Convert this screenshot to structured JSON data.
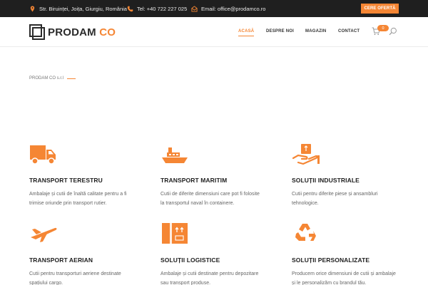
{
  "topbar": {
    "address": "Str. Biruinței, Joița, Giurgiu, România",
    "phone": "Tel: +40 722 227 025",
    "email": "Email: office@prodamco.ro",
    "cta_label": "CERE OFERTĂ",
    "icons": [
      "location-icon",
      "phone-icon",
      "email-icon"
    ]
  },
  "header": {
    "logo_main": "PRODAM",
    "logo_accent": "CO",
    "nav": [
      "ACASĂ",
      "DESPRE NOI",
      "MAGAZIN",
      "CONTACT"
    ],
    "active_nav": "ACASĂ",
    "cart_count": "0"
  },
  "breadcrumb": {
    "text": "PRODAM CO s.r.l"
  },
  "services": [
    {
      "title": "TRANSPORT TERESTRU",
      "desc": "Ambalaje și cutii de înaltă calitate pentru a fi trimise oriunde prin transport rutier.",
      "icon": "truck-icon"
    },
    {
      "title": "TRANSPORT MARITIM",
      "desc": "Cutii de diferite dimensiuni care pot fi folosite la transportul naval în containere.",
      "icon": "ship-icon"
    },
    {
      "title": "SOLUȚII INDUSTRIALE",
      "desc": "Cutii pentru diferite piese și ansambluri tehnologice.",
      "icon": "hand-box-icon"
    },
    {
      "title": "TRANSPORT AERIAN",
      "desc": "Cutii pentru transporturi aeriene destinate spațiului cargo.",
      "icon": "airplane-icon"
    },
    {
      "title": "SOLUȚII LOGISTICE",
      "desc": "Ambalaje și cutii destinate pentru depozitare sau transport produse.",
      "icon": "box-icon"
    },
    {
      "title": "SOLUȚII PERSONALIZATE",
      "desc": "Producem orice dimensiuni de cutii și ambalaje și le personalizăm cu brandul tău.",
      "icon": "recycle-icon"
    }
  ],
  "colors": {
    "accent": "#f58634",
    "topbar_bg": "#1f1f1f",
    "text_dark": "#1e1e1e",
    "text_muted": "#666666"
  }
}
